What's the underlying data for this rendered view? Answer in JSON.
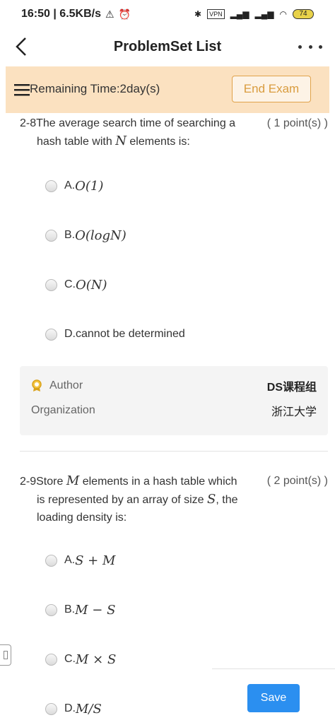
{
  "status_bar": {
    "time_speed": "16:50 | 6.5KB/s",
    "vpn": "VPN",
    "battery": "74"
  },
  "nav": {
    "title": "ProblemSet List"
  },
  "timer": {
    "text": "Remaining Time:2day(s)",
    "end_exam_label": "End Exam"
  },
  "questions": [
    {
      "number": "2-8",
      "text_parts": [
        "The average search time of searching a",
        "hash table with",
        "N",
        "elements is:"
      ],
      "points": "( 1 point(s) )",
      "options": [
        {
          "prefix": "A.",
          "math": "O(1)"
        },
        {
          "prefix": "B.",
          "math": "O(logN)"
        },
        {
          "prefix": "C.",
          "math": "O(N)"
        },
        {
          "prefix": "D.",
          "text": "cannot be determined"
        }
      ],
      "meta": {
        "author_label": "Author",
        "author_value": "DS课程组",
        "organization_label": "Organization",
        "organization_value": "浙江大学"
      }
    },
    {
      "number": "2-9",
      "text_parts": [
        "Store",
        "M",
        "elements in a hash table which",
        "is represented by an array of size",
        "S",
        ", the",
        "loading density is:"
      ],
      "points": "( 2 point(s) )",
      "options": [
        {
          "prefix": "A.",
          "math": "S + M"
        },
        {
          "prefix": "B.",
          "math": "M − S"
        },
        {
          "prefix": "C.",
          "math": "M × S"
        },
        {
          "prefix": "D.",
          "math": "M/S"
        }
      ]
    }
  ],
  "footer": {
    "save_label": "Save"
  },
  "colors": {
    "timer_bg": "#fbe1c0",
    "end_exam_border": "#e0a24a",
    "save_bg": "#2b8ff0"
  }
}
